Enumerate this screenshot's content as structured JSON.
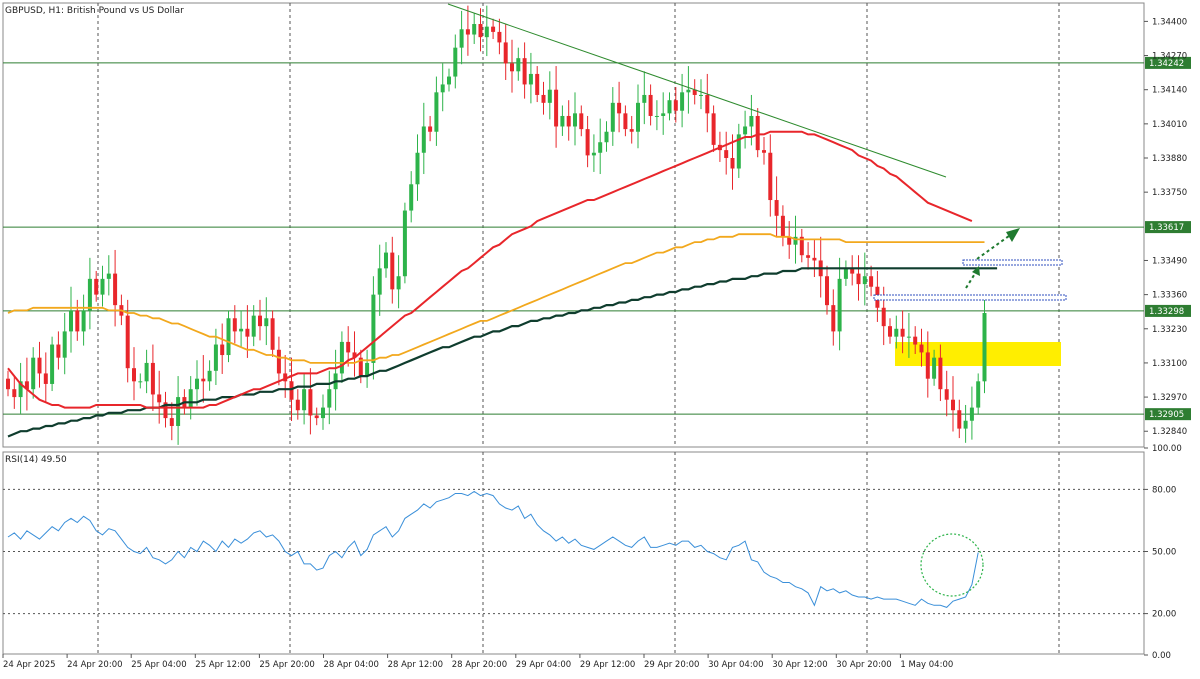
{
  "chart_data": [
    {
      "type": "candlestick",
      "title": "GBPUSD, H1:  British Pound vs US Dollar",
      "ylim": [
        1.3278,
        1.3447
      ],
      "y_ticks": [
        "1.34400",
        "1.34270",
        "1.34140",
        "1.34010",
        "1.33880",
        "1.33750",
        "1.33490",
        "1.33360",
        "1.33230",
        "1.33100",
        "1.32970",
        "1.32840"
      ],
      "horizontal_levels": [
        {
          "value": 1.34242,
          "label": "1.34242",
          "color": "#2e7d32"
        },
        {
          "value": 1.33617,
          "label": "1.33617",
          "color": "#2e7d32"
        },
        {
          "value": 1.33298,
          "label": "1.33298",
          "color": "#2e7d32"
        },
        {
          "value": 1.32905,
          "label": "1.32905",
          "color": "#2e7d32"
        }
      ],
      "x_labels": [
        "24 Apr 2025",
        "24 Apr 20:00",
        "25 Apr 04:00",
        "25 Apr 12:00",
        "25 Apr 20:00",
        "28 Apr 04:00",
        "28 Apr 12:00",
        "28 Apr 20:00",
        "29 Apr 04:00",
        "29 Apr 12:00",
        "29 Apr 20:00",
        "30 Apr 04:00",
        "30 Apr 12:00",
        "30 Apr 20:00",
        "1 May 04:00"
      ],
      "colors": {
        "up": "#2db34a",
        "down": "#e8262b",
        "ma_fast": "#e8262b",
        "ma_mid": "#f2a81d",
        "ma_slow": "#0f3d2e",
        "trendline": "#2e8b2e",
        "zone": "#ffee00",
        "grid": "#555555"
      },
      "closes": [
        1.33,
        1.3297,
        1.3303,
        1.33,
        1.3312,
        1.3306,
        1.3302,
        1.3317,
        1.3312,
        1.3322,
        1.333,
        1.3322,
        1.333,
        1.3342,
        1.3336,
        1.3342,
        1.3344,
        1.3332,
        1.3328,
        1.3308,
        1.3303,
        1.3303,
        1.331,
        1.3298,
        1.3295,
        1.3289,
        1.3286,
        1.3297,
        1.3293,
        1.33,
        1.3304,
        1.3303,
        1.3307,
        1.3317,
        1.3313,
        1.3327,
        1.3322,
        1.3323,
        1.332,
        1.3328,
        1.3324,
        1.3327,
        1.3315,
        1.3306,
        1.3303,
        1.3296,
        1.3292,
        1.33,
        1.329,
        1.3289,
        1.3293,
        1.33,
        1.3306,
        1.3318,
        1.3314,
        1.3312,
        1.3305,
        1.331,
        1.3336,
        1.3346,
        1.3352,
        1.3338,
        1.3343,
        1.3368,
        1.3378,
        1.339,
        1.34,
        1.3398,
        1.3413,
        1.3416,
        1.3419,
        1.343,
        1.3437,
        1.3435,
        1.3439,
        1.3434,
        1.3438,
        1.3436,
        1.3432,
        1.3424,
        1.3421,
        1.3426,
        1.3416,
        1.342,
        1.3412,
        1.3409,
        1.3414,
        1.34,
        1.3404,
        1.34,
        1.3405,
        1.3399,
        1.3389,
        1.339,
        1.3394,
        1.3398,
        1.3409,
        1.3405,
        1.3399,
        1.3398,
        1.3409,
        1.3412,
        1.3404,
        1.3404,
        1.3405,
        1.341,
        1.3406,
        1.3413,
        1.3414,
        1.3412,
        1.3412,
        1.3405,
        1.3393,
        1.3391,
        1.3388,
        1.3384,
        1.3397,
        1.34,
        1.3404,
        1.3391,
        1.339,
        1.3372,
        1.3366,
        1.3358,
        1.3355,
        1.3358,
        1.3351,
        1.335,
        1.3349,
        1.3343,
        1.3332,
        1.3322,
        1.3342,
        1.3346,
        1.3344,
        1.334,
        1.3343,
        1.3339,
        1.3331,
        1.3324,
        1.332,
        1.3323,
        1.332,
        1.332,
        1.3317,
        1.3314,
        1.3304,
        1.3312,
        1.33,
        1.3296,
        1.3292,
        1.3285,
        1.3288,
        1.3293,
        1.3303,
        1.3329
      ],
      "ma_fast": [
        1.3308,
        1.3305,
        1.3302,
        1.33,
        1.3298,
        1.3296,
        1.3295,
        1.3294,
        1.3294,
        1.3293,
        1.3293,
        1.3293,
        1.3293,
        1.3293,
        1.3294,
        1.3294,
        1.3294,
        1.3294,
        1.3294,
        1.3294,
        1.3294,
        1.3294,
        1.3293,
        1.3293,
        1.3293,
        1.3293,
        1.3293,
        1.3293,
        1.3293,
        1.3293,
        1.3293,
        1.3293,
        1.3294,
        1.3294,
        1.3295,
        1.3296,
        1.3297,
        1.3298,
        1.3299,
        1.33,
        1.33,
        1.3301,
        1.3302,
        1.3303,
        1.3304,
        1.3305,
        1.3306,
        1.3306,
        1.3306,
        1.3306,
        1.3307,
        1.3308,
        1.3308,
        1.3309,
        1.3311,
        1.3312,
        1.3314,
        1.3316,
        1.3318,
        1.332,
        1.3322,
        1.3324,
        1.3326,
        1.3328,
        1.3329,
        1.3331,
        1.3333,
        1.3335,
        1.3337,
        1.3339,
        1.3341,
        1.3343,
        1.3345,
        1.3346,
        1.3348,
        1.335,
        1.3352,
        1.3354,
        1.3355,
        1.3357,
        1.3359,
        1.336,
        1.3361,
        1.3362,
        1.3364,
        1.3365,
        1.3366,
        1.3367,
        1.3368,
        1.3369,
        1.337,
        1.3371,
        1.3372,
        1.3372,
        1.3373,
        1.3374,
        1.3375,
        1.3376,
        1.3377,
        1.3378,
        1.3379,
        1.338,
        1.3381,
        1.3382,
        1.3383,
        1.3384,
        1.3385,
        1.3386,
        1.3387,
        1.3388,
        1.3389,
        1.339,
        1.3391,
        1.3392,
        1.3393,
        1.3394,
        1.3395,
        1.3396,
        1.3396,
        1.3397,
        1.3397,
        1.3398,
        1.3398,
        1.3398,
        1.3398,
        1.3398,
        1.3398,
        1.3397,
        1.3397,
        1.3396,
        1.3395,
        1.3394,
        1.3393,
        1.3392,
        1.3391,
        1.3389,
        1.3388,
        1.3387,
        1.3385,
        1.3384,
        1.3382,
        1.3381,
        1.3379,
        1.3377,
        1.3375,
        1.3373,
        1.3371,
        1.337,
        1.3369,
        1.3368,
        1.3367,
        1.3366,
        1.3365,
        1.3364
      ],
      "ma_mid": [
        1.3329,
        1.333,
        1.333,
        1.333,
        1.3331,
        1.3331,
        1.3331,
        1.3331,
        1.3331,
        1.3331,
        1.3331,
        1.3331,
        1.3331,
        1.3331,
        1.3331,
        1.3331,
        1.333,
        1.333,
        1.333,
        1.3329,
        1.3329,
        1.3328,
        1.3328,
        1.3327,
        1.3327,
        1.3326,
        1.3325,
        1.3325,
        1.3324,
        1.3323,
        1.3322,
        1.3321,
        1.332,
        1.332,
        1.3319,
        1.3318,
        1.3317,
        1.3316,
        1.3315,
        1.3315,
        1.3314,
        1.3313,
        1.3313,
        1.3312,
        1.3312,
        1.3311,
        1.3311,
        1.3311,
        1.331,
        1.331,
        1.331,
        1.331,
        1.331,
        1.331,
        1.331,
        1.331,
        1.3311,
        1.3311,
        1.3311,
        1.3312,
        1.3312,
        1.3313,
        1.3313,
        1.3314,
        1.3315,
        1.3316,
        1.3317,
        1.3318,
        1.3319,
        1.332,
        1.3321,
        1.3322,
        1.3323,
        1.3324,
        1.3325,
        1.3326,
        1.3326,
        1.3327,
        1.3328,
        1.3329,
        1.333,
        1.3331,
        1.3332,
        1.3333,
        1.3334,
        1.3335,
        1.3336,
        1.3337,
        1.3338,
        1.3339,
        1.334,
        1.3341,
        1.3342,
        1.3343,
        1.3344,
        1.3345,
        1.3346,
        1.3347,
        1.3348,
        1.3348,
        1.3349,
        1.335,
        1.3351,
        1.3352,
        1.3352,
        1.3353,
        1.3354,
        1.3354,
        1.3355,
        1.3356,
        1.3356,
        1.3357,
        1.3357,
        1.3358,
        1.3358,
        1.3358,
        1.3359,
        1.3359,
        1.3359,
        1.3359,
        1.3359,
        1.3359,
        1.3358,
        1.3358,
        1.3358,
        1.3357,
        1.3357,
        1.3357,
        1.3357,
        1.3357,
        1.3357,
        1.3357,
        1.3357,
        1.3356,
        1.3356,
        1.3356,
        1.3356,
        1.3356,
        1.3356,
        1.3356,
        1.3356,
        1.3356,
        1.3356,
        1.3356,
        1.3356,
        1.3356,
        1.3356,
        1.3356,
        1.3356,
        1.3356,
        1.3356,
        1.3356,
        1.3356,
        1.3356,
        1.3356,
        1.3356
      ],
      "ma_slow": [
        1.3282,
        1.3283,
        1.3284,
        1.3284,
        1.3285,
        1.3285,
        1.3286,
        1.3286,
        1.3287,
        1.3287,
        1.3288,
        1.3288,
        1.3289,
        1.3289,
        1.329,
        1.329,
        1.3291,
        1.3291,
        1.3291,
        1.3292,
        1.3292,
        1.3292,
        1.3293,
        1.3293,
        1.3293,
        1.3294,
        1.3294,
        1.3294,
        1.3295,
        1.3295,
        1.3295,
        1.3296,
        1.3296,
        1.3296,
        1.3297,
        1.3297,
        1.3297,
        1.3298,
        1.3298,
        1.3298,
        1.3299,
        1.3299,
        1.3299,
        1.33,
        1.33,
        1.33,
        1.3301,
        1.3301,
        1.3301,
        1.3302,
        1.3302,
        1.3302,
        1.3303,
        1.3303,
        1.3304,
        1.3304,
        1.3305,
        1.3305,
        1.3306,
        1.3307,
        1.3307,
        1.3308,
        1.3309,
        1.331,
        1.3311,
        1.3312,
        1.3313,
        1.3314,
        1.3315,
        1.3316,
        1.3316,
        1.3317,
        1.3318,
        1.3319,
        1.332,
        1.332,
        1.3321,
        1.3322,
        1.3322,
        1.3323,
        1.3324,
        1.3324,
        1.3325,
        1.3326,
        1.3326,
        1.3327,
        1.3327,
        1.3328,
        1.3328,
        1.3329,
        1.3329,
        1.333,
        1.333,
        1.3331,
        1.3331,
        1.3332,
        1.3332,
        1.3333,
        1.3333,
        1.3334,
        1.3334,
        1.3335,
        1.3335,
        1.3336,
        1.3336,
        1.3337,
        1.3337,
        1.3338,
        1.3338,
        1.3339,
        1.3339,
        1.334,
        1.334,
        1.3341,
        1.3341,
        1.3342,
        1.3342,
        1.3342,
        1.3343,
        1.3343,
        1.3344,
        1.3344,
        1.3344,
        1.3345,
        1.3345,
        1.3345,
        1.3346,
        1.3346,
        1.3346,
        1.3346,
        1.3346,
        1.3346,
        1.3346,
        1.3346,
        1.3346,
        1.3346,
        1.3346,
        1.3346,
        1.3346,
        1.3346,
        1.3346,
        1.3346,
        1.3346,
        1.3346,
        1.3346,
        1.3346,
        1.3346,
        1.3346,
        1.3346,
        1.3346,
        1.3346,
        1.3346,
        1.3346,
        1.3346,
        1.3346,
        1.3346,
        1.3346,
        1.3346
      ]
    },
    {
      "type": "line",
      "title": "RSI(14) 49.50",
      "ylim": [
        0,
        100
      ],
      "y_ticks": [
        "100.00",
        "80.00",
        "50.00",
        "20.00",
        "0.00"
      ],
      "levels": [
        80,
        50,
        20
      ],
      "series": [
        {
          "color": "#3a8fd9",
          "values": [
            57,
            59,
            56,
            60,
            58,
            56,
            59,
            62,
            60,
            64,
            66,
            64,
            67,
            65,
            60,
            58,
            61,
            60,
            56,
            52,
            50,
            49,
            52,
            47,
            46,
            44,
            46,
            50,
            47,
            52,
            50,
            55,
            53,
            50,
            55,
            52,
            56,
            54,
            56,
            59,
            60,
            57,
            58,
            55,
            50,
            48,
            50,
            44,
            44,
            41,
            42,
            48,
            50,
            47,
            52,
            55,
            48,
            51,
            58,
            60,
            62,
            57,
            60,
            66,
            68,
            70,
            73,
            71,
            74,
            75,
            76,
            78,
            78,
            77,
            79,
            77,
            78,
            77,
            73,
            71,
            70,
            72,
            66,
            68,
            63,
            60,
            58,
            55,
            57,
            54,
            56,
            53,
            52,
            51,
            53,
            55,
            57,
            55,
            53,
            52,
            55,
            57,
            52,
            52,
            53,
            54,
            53,
            55,
            55,
            52,
            53,
            50,
            49,
            47,
            46,
            52,
            53,
            55,
            46,
            45,
            40,
            38,
            37,
            35,
            35,
            33,
            32,
            30,
            24,
            33,
            31,
            32,
            30,
            31,
            29,
            28,
            28,
            27,
            28,
            27,
            27,
            27,
            26,
            25,
            24,
            27,
            25,
            24,
            24,
            23,
            26,
            27,
            28,
            34,
            49.5
          ]
        }
      ]
    }
  ]
}
